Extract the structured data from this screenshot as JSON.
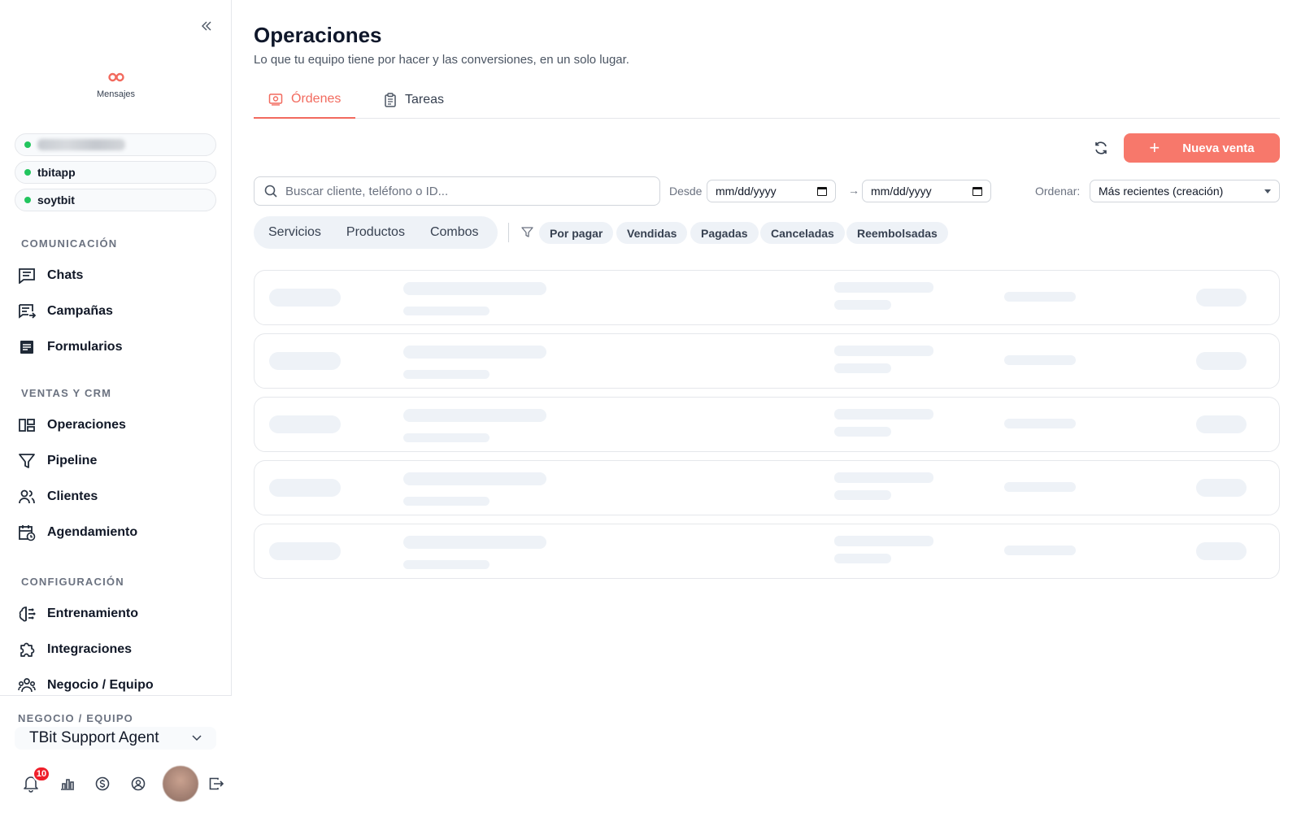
{
  "sidebar": {
    "brand_label": "Mensajes",
    "accounts": [
      {
        "label": "",
        "status": "online"
      },
      {
        "label": "tbitapp",
        "status": "online"
      },
      {
        "label": "soytbit",
        "status": "online"
      }
    ],
    "sections": [
      {
        "title": "COMUNICACIÓN",
        "items": [
          {
            "label": "Chats",
            "icon": "chat-icon"
          },
          {
            "label": "Campañas",
            "icon": "campaign-icon"
          },
          {
            "label": "Formularios",
            "icon": "form-icon"
          }
        ]
      },
      {
        "title": "VENTAS Y CRM",
        "items": [
          {
            "label": "Operaciones",
            "icon": "operations-icon"
          },
          {
            "label": "Pipeline",
            "icon": "funnel-icon"
          },
          {
            "label": "Clientes",
            "icon": "clients-icon"
          },
          {
            "label": "Agendamiento",
            "icon": "calendar-icon"
          }
        ]
      },
      {
        "title": "CONFIGURACIÓN",
        "items": [
          {
            "label": "Entrenamiento",
            "icon": "brain-icon"
          },
          {
            "label": "Integraciones",
            "icon": "puzzle-icon"
          },
          {
            "label": "Negocio / Equipo",
            "icon": "team-icon"
          }
        ]
      }
    ],
    "footer": {
      "team_title": "NEGOCIO / EQUIPO",
      "team_name": "TBit Support Agent",
      "notification_count": "10"
    }
  },
  "main": {
    "title": "Operaciones",
    "subtitle": "Lo que tu equipo tiene por hacer y las conversiones, en un solo lugar.",
    "tabs": [
      {
        "label": "Órdenes",
        "active": true
      },
      {
        "label": "Tareas",
        "active": false
      }
    ],
    "new_sale_label": "Nueva venta",
    "search_placeholder": "Buscar cliente, teléfono o ID...",
    "from_label": "Desde",
    "date_from": "mm/dd/yyyy",
    "date_to": "mm/dd/yyyy",
    "sort_label": "Ordenar:",
    "sort_value": "Más recientes (creación)",
    "type_filters": [
      "Servicios",
      "Productos",
      "Combos"
    ],
    "status_chips": [
      "Por pagar",
      "Vendidas",
      "Pagadas",
      "Canceladas",
      "Reembolsadas"
    ],
    "accent_color": "#f7786b"
  }
}
